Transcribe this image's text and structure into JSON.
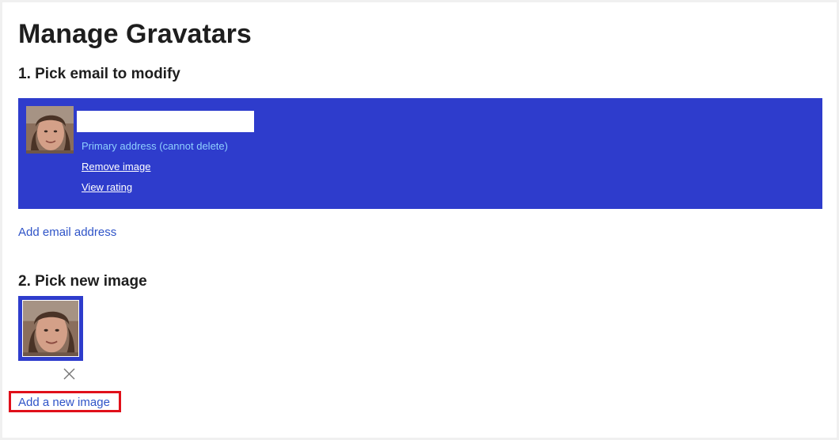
{
  "page": {
    "title": "Manage Gravatars"
  },
  "step1": {
    "title": "1. Pick email to modify",
    "email": {
      "value": "",
      "primary_note": "Primary address (cannot delete)",
      "remove_label": "Remove image",
      "rating_label": "View rating"
    },
    "add_email_label": "Add email address"
  },
  "step2": {
    "title": "2. Pick new image",
    "add_image_label": "Add a new image"
  },
  "colors": {
    "accent": "#2e3ccc",
    "link": "#2f54c8",
    "highlight": "#e0101a",
    "primary_note": "#8fd0ff"
  },
  "icons": {
    "delete": "close-icon",
    "avatar": "face-photo"
  }
}
